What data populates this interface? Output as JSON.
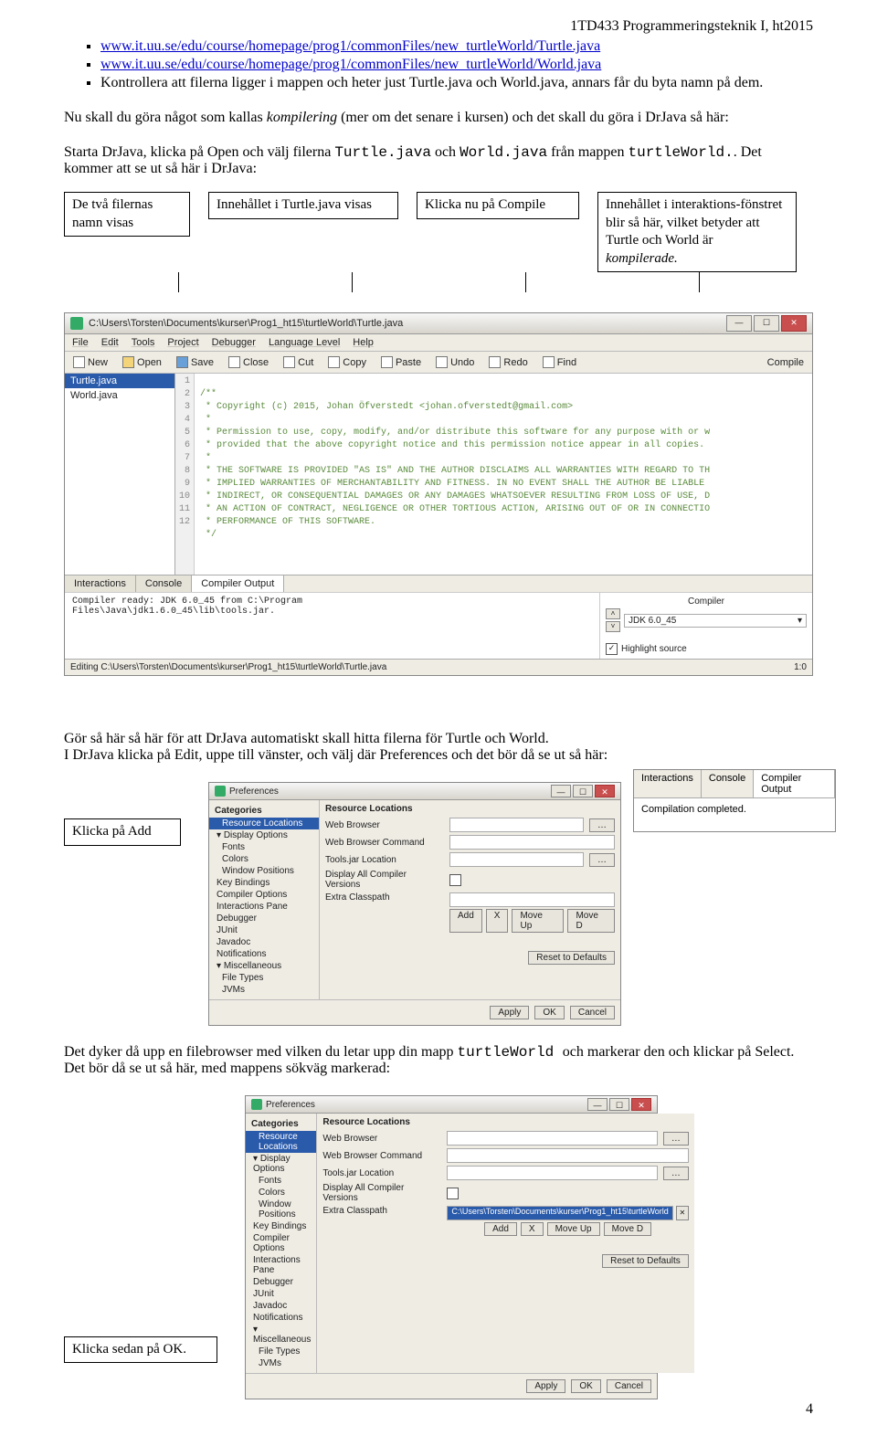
{
  "header": {
    "course": "1TD433 Programmeringsteknik I, ht2015"
  },
  "bullets": {
    "link1": "www.it.uu.se/edu/course/homepage/prog1/commonFiles/new_turtleWorld/Turtle.java",
    "link2": "www.it.uu.se/edu/course/homepage/prog1/commonFiles/new_turtleWorld/World.java",
    "b3": "Kontrollera att filerna ligger i mappen och heter just Turtle.java och World.java, annars får du byta namn på dem."
  },
  "para1a": "Nu skall du göra något som kallas ",
  "para1i": "kompilering",
  "para1b": " (mer om det senare i kursen) och det skall du göra i DrJava så här:",
  "para2a": "Starta DrJava, klicka på Open och välj filerna ",
  "para2m1": "Turtle.java",
  "para2b": " och ",
  "para2m2": "World.java",
  "para2c": " från mappen ",
  "para2m3": "turtleWorld.",
  "para2d": ". Det kommer att se ut så här i DrJava:",
  "callouts": {
    "c1": "De två filernas namn  visas",
    "c2": "Innehållet i Turtle.java visas",
    "c3": "Klicka nu på Compile",
    "c4a": "Innehållet i interaktions-fönstret  blir så här, vilket betyder att Turtle och World är ",
    "c4b": "kompilerade."
  },
  "drjava": {
    "title": "C:\\Users\\Torsten\\Documents\\kurser\\Prog1_ht15\\turtleWorld\\Turtle.java",
    "menu": [
      "File",
      "Edit",
      "Tools",
      "Project",
      "Debugger",
      "Language Level",
      "Help"
    ],
    "toolbar": [
      "New",
      "Open",
      "Save",
      "Close",
      "Cut",
      "Copy",
      "Paste",
      "Undo",
      "Redo",
      "Find",
      "Compile"
    ],
    "files": [
      "Turtle.java",
      "World.java"
    ],
    "code_lines": [
      "/**",
      " * Copyright (c) 2015, Johan Öfverstedt <johan.ofverstedt@gmail.com>",
      " *",
      " * Permission to use, copy, modify, and/or distribute this software for any purpose with or w",
      " * provided that the above copyright notice and this permission notice appear in all copies.",
      " *",
      " * THE SOFTWARE IS PROVIDED \"AS IS\" AND THE AUTHOR DISCLAIMS ALL WARRANTIES WITH REGARD TO TH",
      " * IMPLIED WARRANTIES OF MERCHANTABILITY AND FITNESS. IN NO EVENT SHALL THE AUTHOR BE LIABLE",
      " * INDIRECT, OR CONSEQUENTIAL DAMAGES OR ANY DAMAGES WHATSOEVER RESULTING FROM LOSS OF USE, D",
      " * AN ACTION OF CONTRACT, NEGLIGENCE OR OTHER TORTIOUS ACTION, ARISING OUT OF OR IN CONNECTIO",
      " * PERFORMANCE OF THIS SOFTWARE.",
      " */"
    ],
    "line_numbers": [
      "1",
      "2",
      "3",
      "4",
      "5",
      "6",
      "7",
      "8",
      "9",
      "10",
      "11",
      "12"
    ],
    "tabs": [
      "Interactions",
      "Console",
      "Compiler Output"
    ],
    "bottom_left": "Compiler ready: JDK 6.0_45 from C:\\Program\nFiles\\Java\\jdk1.6.0_45\\lib\\tools.jar.",
    "compiler_label": "Compiler",
    "compiler_value": "JDK 6.0_45",
    "highlight": "Highlight source",
    "status_left": "Editing C:\\Users\\Torsten\\Documents\\kurser\\Prog1_ht15\\turtleWorld\\Turtle.java",
    "status_right": "1:0"
  },
  "inter_panel": {
    "tabs": [
      "Interactions",
      "Console",
      "Compiler Output"
    ],
    "text": "Compilation completed."
  },
  "para3": "Gör så här så här för att DrJava automatiskt skall hitta filerna för Turtle och World.\nI DrJava klicka på Edit, uppe till vänster, och välj där Preferences och det  bör då se ut så här:",
  "callouts2": {
    "add": "Klicka på Add"
  },
  "prefs1": {
    "title": "Preferences",
    "cats_header": "Categories",
    "cats": [
      {
        "t": "Resource Locations",
        "sel": true,
        "indent": 0
      },
      {
        "t": "Display Options",
        "grp": true
      },
      {
        "t": "Fonts",
        "indent": 1
      },
      {
        "t": "Colors",
        "indent": 1
      },
      {
        "t": "Window Positions",
        "indent": 1
      },
      {
        "t": "Key Bindings",
        "indent": 0
      },
      {
        "t": "Compiler Options",
        "indent": 0
      },
      {
        "t": "Interactions Pane",
        "indent": 0
      },
      {
        "t": "Debugger",
        "indent": 0
      },
      {
        "t": "JUnit",
        "indent": 0
      },
      {
        "t": "Javadoc",
        "indent": 0
      },
      {
        "t": "Notifications",
        "indent": 0
      },
      {
        "t": "Miscellaneous",
        "grp": true
      },
      {
        "t": "File Types",
        "indent": 1
      },
      {
        "t": "JVMs",
        "indent": 1
      }
    ],
    "main_header": "Resource Locations",
    "rows": [
      {
        "lbl": "Web Browser",
        "val": ""
      },
      {
        "lbl": "Web Browser Command",
        "val": ""
      },
      {
        "lbl": "Tools.jar Location",
        "val": ""
      },
      {
        "lbl": "Display All Compiler Versions",
        "checkbox": true
      },
      {
        "lbl": "Extra Classpath",
        "buttons": [
          "Add",
          "X",
          "Move Up",
          "Move D"
        ]
      }
    ],
    "reset": "Reset to Defaults",
    "foot": [
      "Apply",
      "OK",
      "Cancel"
    ]
  },
  "para4a": "Det dyker då upp en filebrowser med vilken du letar upp din mapp ",
  "para4m": "turtleWorld ",
  "para4b": "och markerar den och klickar på Select. Det bör då se ut så här, med mappens sökväg markerad:",
  "callouts3": {
    "ok": "Klicka sedan på OK."
  },
  "prefs2": {
    "title": "Preferences",
    "classpath": "C:\\Users\\Torsten\\Documents\\kurser\\Prog1_ht15\\turtleWorld"
  },
  "page_number": "4"
}
